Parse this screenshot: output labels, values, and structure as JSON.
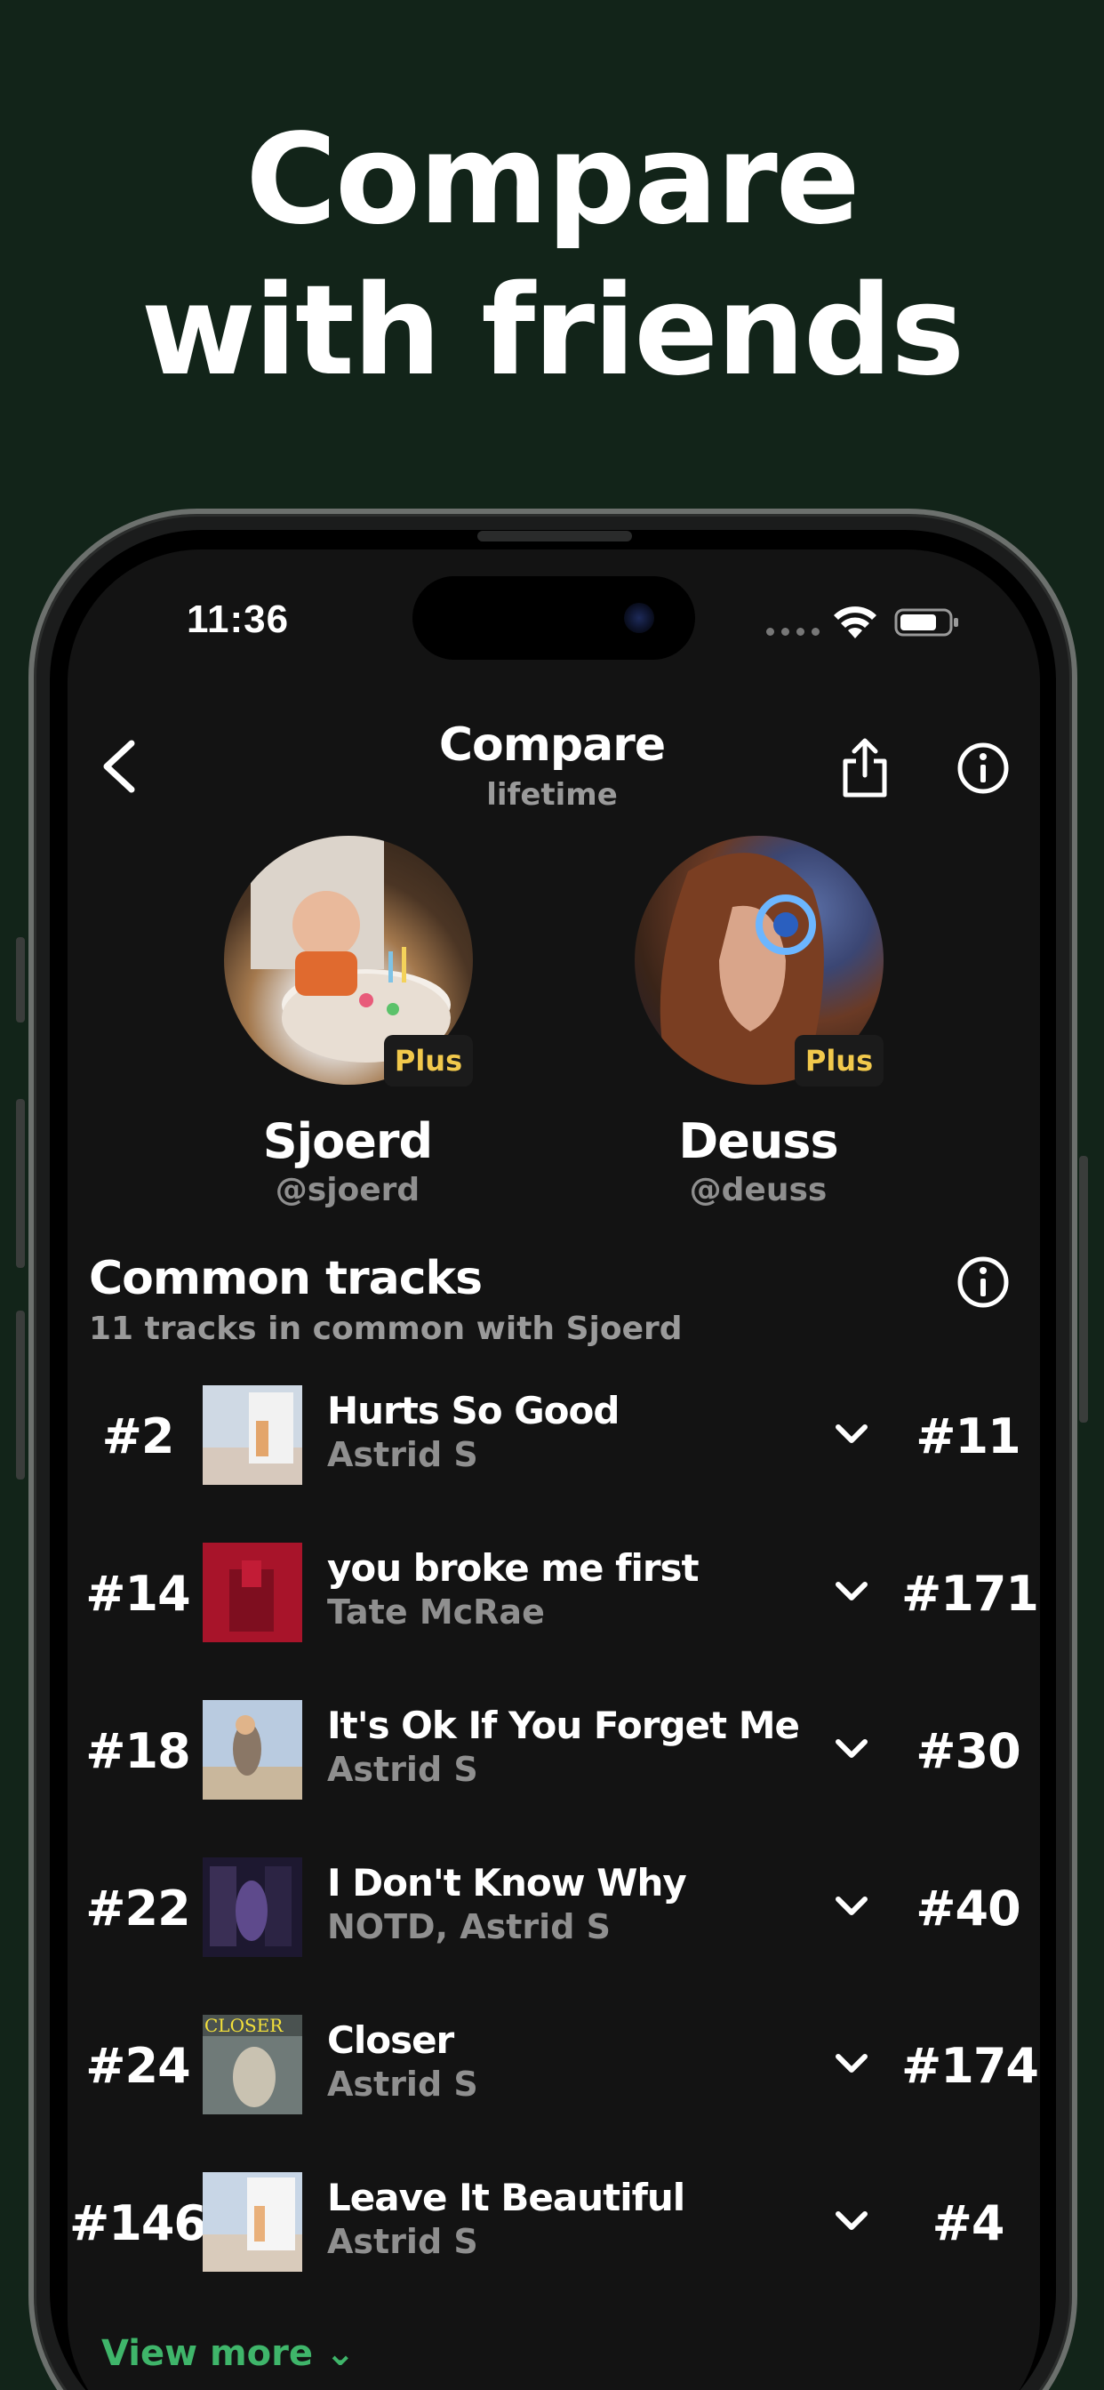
{
  "headline": {
    "line1": "Compare",
    "line2": "with friends"
  },
  "status_bar": {
    "time": "11:36"
  },
  "nav": {
    "title": "Compare",
    "subtitle": "lifetime"
  },
  "users": [
    {
      "name": "Sjoerd",
      "handle": "@sjoerd",
      "badge": "Plus"
    },
    {
      "name": "Deuss",
      "handle": "@deuss",
      "badge": "Plus"
    }
  ],
  "common_tracks": {
    "title": "Common tracks",
    "subtitle": "11 tracks in common with Sjoerd",
    "tracks": [
      {
        "left_rank": "#2",
        "title": "Hurts So Good",
        "artist": "Astrid S",
        "right_rank": "#11"
      },
      {
        "left_rank": "#14",
        "title": "you broke me first",
        "artist": "Tate McRae",
        "right_rank": "#171"
      },
      {
        "left_rank": "#18",
        "title": "It's Ok If You Forget Me",
        "artist": "Astrid S",
        "right_rank": "#30"
      },
      {
        "left_rank": "#22",
        "title": "I Don't Know Why",
        "artist": "NOTD, Astrid S",
        "right_rank": "#40"
      },
      {
        "left_rank": "#24",
        "title": "Closer",
        "artist": "Astrid S",
        "right_rank": "#174"
      },
      {
        "left_rank": "#146",
        "title": "Leave It Beautiful",
        "artist": "Astrid S",
        "right_rank": "#4"
      }
    ],
    "closer_cover_text": "CLOSER",
    "view_more": "View more"
  },
  "colors": {
    "background": "#122419",
    "screen": "#131313",
    "badge_text": "#f2c94c",
    "accent_green": "#3fb56a",
    "muted_text": "#8f8f8f"
  }
}
